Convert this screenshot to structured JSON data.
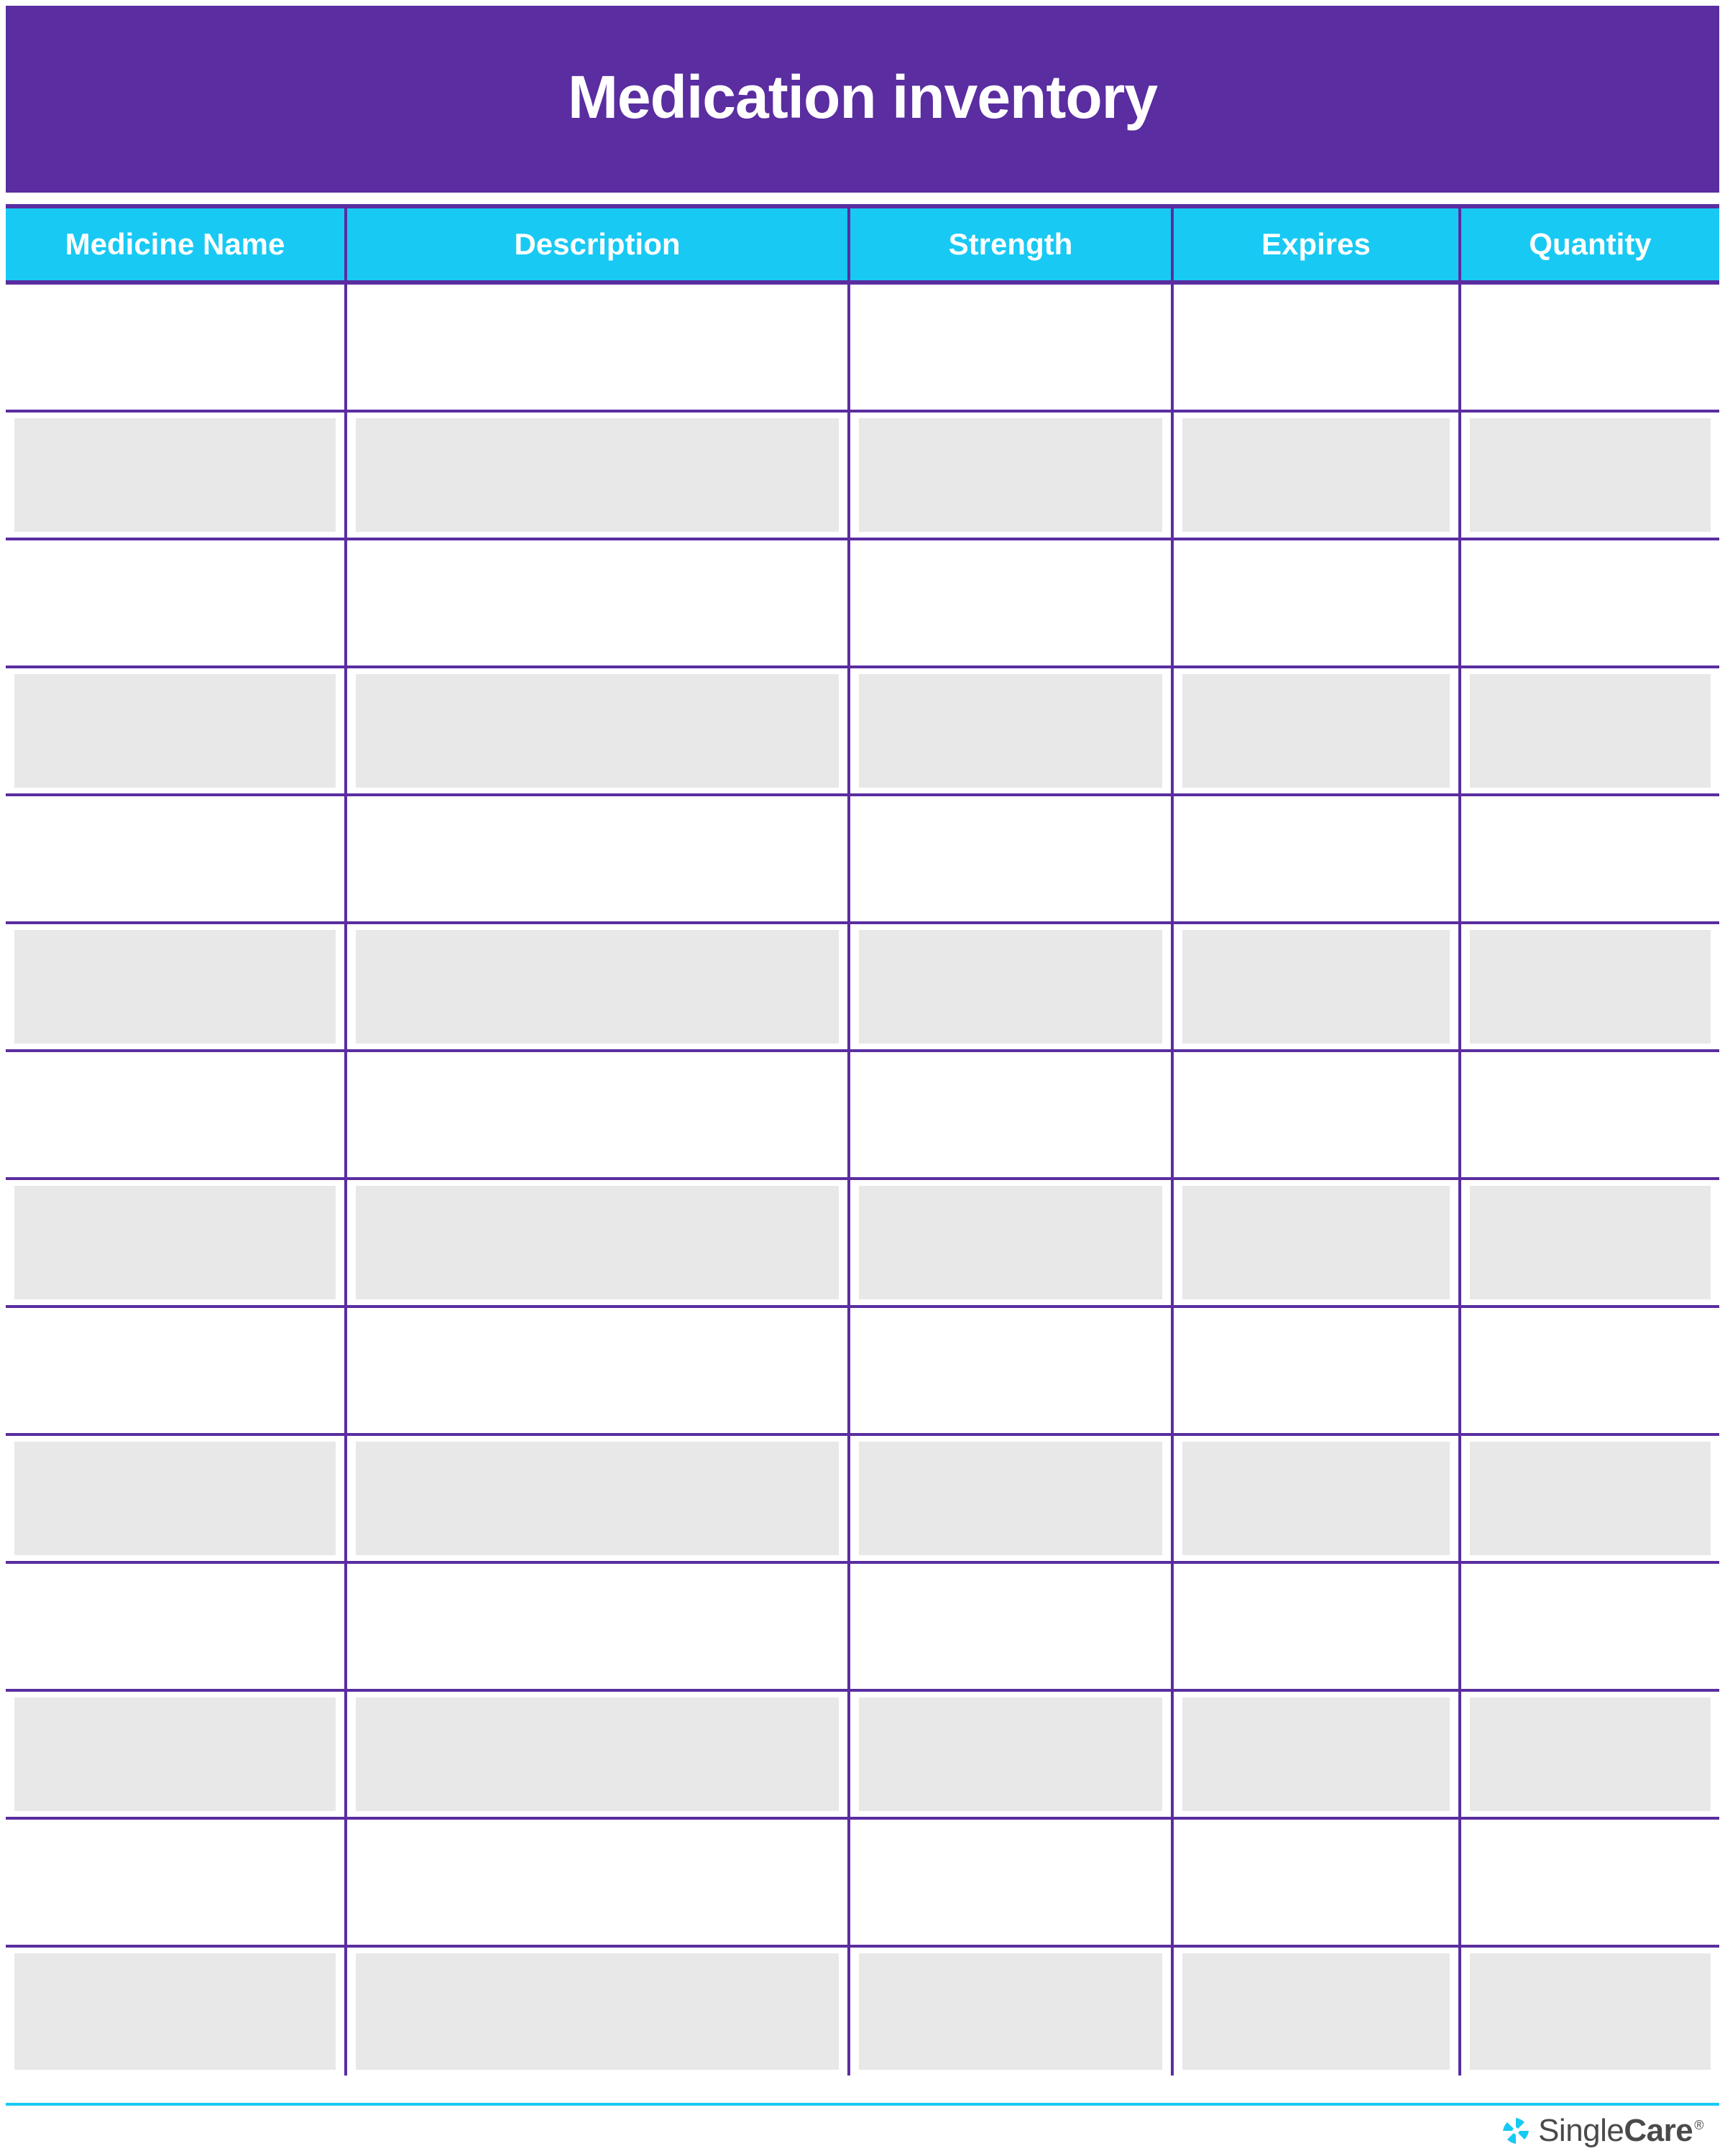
{
  "title": "Medication inventory",
  "columns": [
    "Medicine Name",
    "Description",
    "Strength",
    "Expires",
    "Quantity"
  ],
  "rows": [
    {
      "medicine_name": "",
      "description": "",
      "strength": "",
      "expires": "",
      "quantity": ""
    },
    {
      "medicine_name": "",
      "description": "",
      "strength": "",
      "expires": "",
      "quantity": ""
    },
    {
      "medicine_name": "",
      "description": "",
      "strength": "",
      "expires": "",
      "quantity": ""
    },
    {
      "medicine_name": "",
      "description": "",
      "strength": "",
      "expires": "",
      "quantity": ""
    },
    {
      "medicine_name": "",
      "description": "",
      "strength": "",
      "expires": "",
      "quantity": ""
    },
    {
      "medicine_name": "",
      "description": "",
      "strength": "",
      "expires": "",
      "quantity": ""
    },
    {
      "medicine_name": "",
      "description": "",
      "strength": "",
      "expires": "",
      "quantity": ""
    },
    {
      "medicine_name": "",
      "description": "",
      "strength": "",
      "expires": "",
      "quantity": ""
    },
    {
      "medicine_name": "",
      "description": "",
      "strength": "",
      "expires": "",
      "quantity": ""
    },
    {
      "medicine_name": "",
      "description": "",
      "strength": "",
      "expires": "",
      "quantity": ""
    },
    {
      "medicine_name": "",
      "description": "",
      "strength": "",
      "expires": "",
      "quantity": ""
    },
    {
      "medicine_name": "",
      "description": "",
      "strength": "",
      "expires": "",
      "quantity": ""
    },
    {
      "medicine_name": "",
      "description": "",
      "strength": "",
      "expires": "",
      "quantity": ""
    },
    {
      "medicine_name": "",
      "description": "",
      "strength": "",
      "expires": "",
      "quantity": ""
    }
  ],
  "brand": {
    "name_light": "Single",
    "name_bold": "Care",
    "registered": "®",
    "icon_color": "#18C9F3"
  },
  "colors": {
    "header_bg": "#5A2DA0",
    "col_header_bg": "#18C9F3",
    "border": "#5A2DA0",
    "alt_row": "#E8E8E8"
  }
}
